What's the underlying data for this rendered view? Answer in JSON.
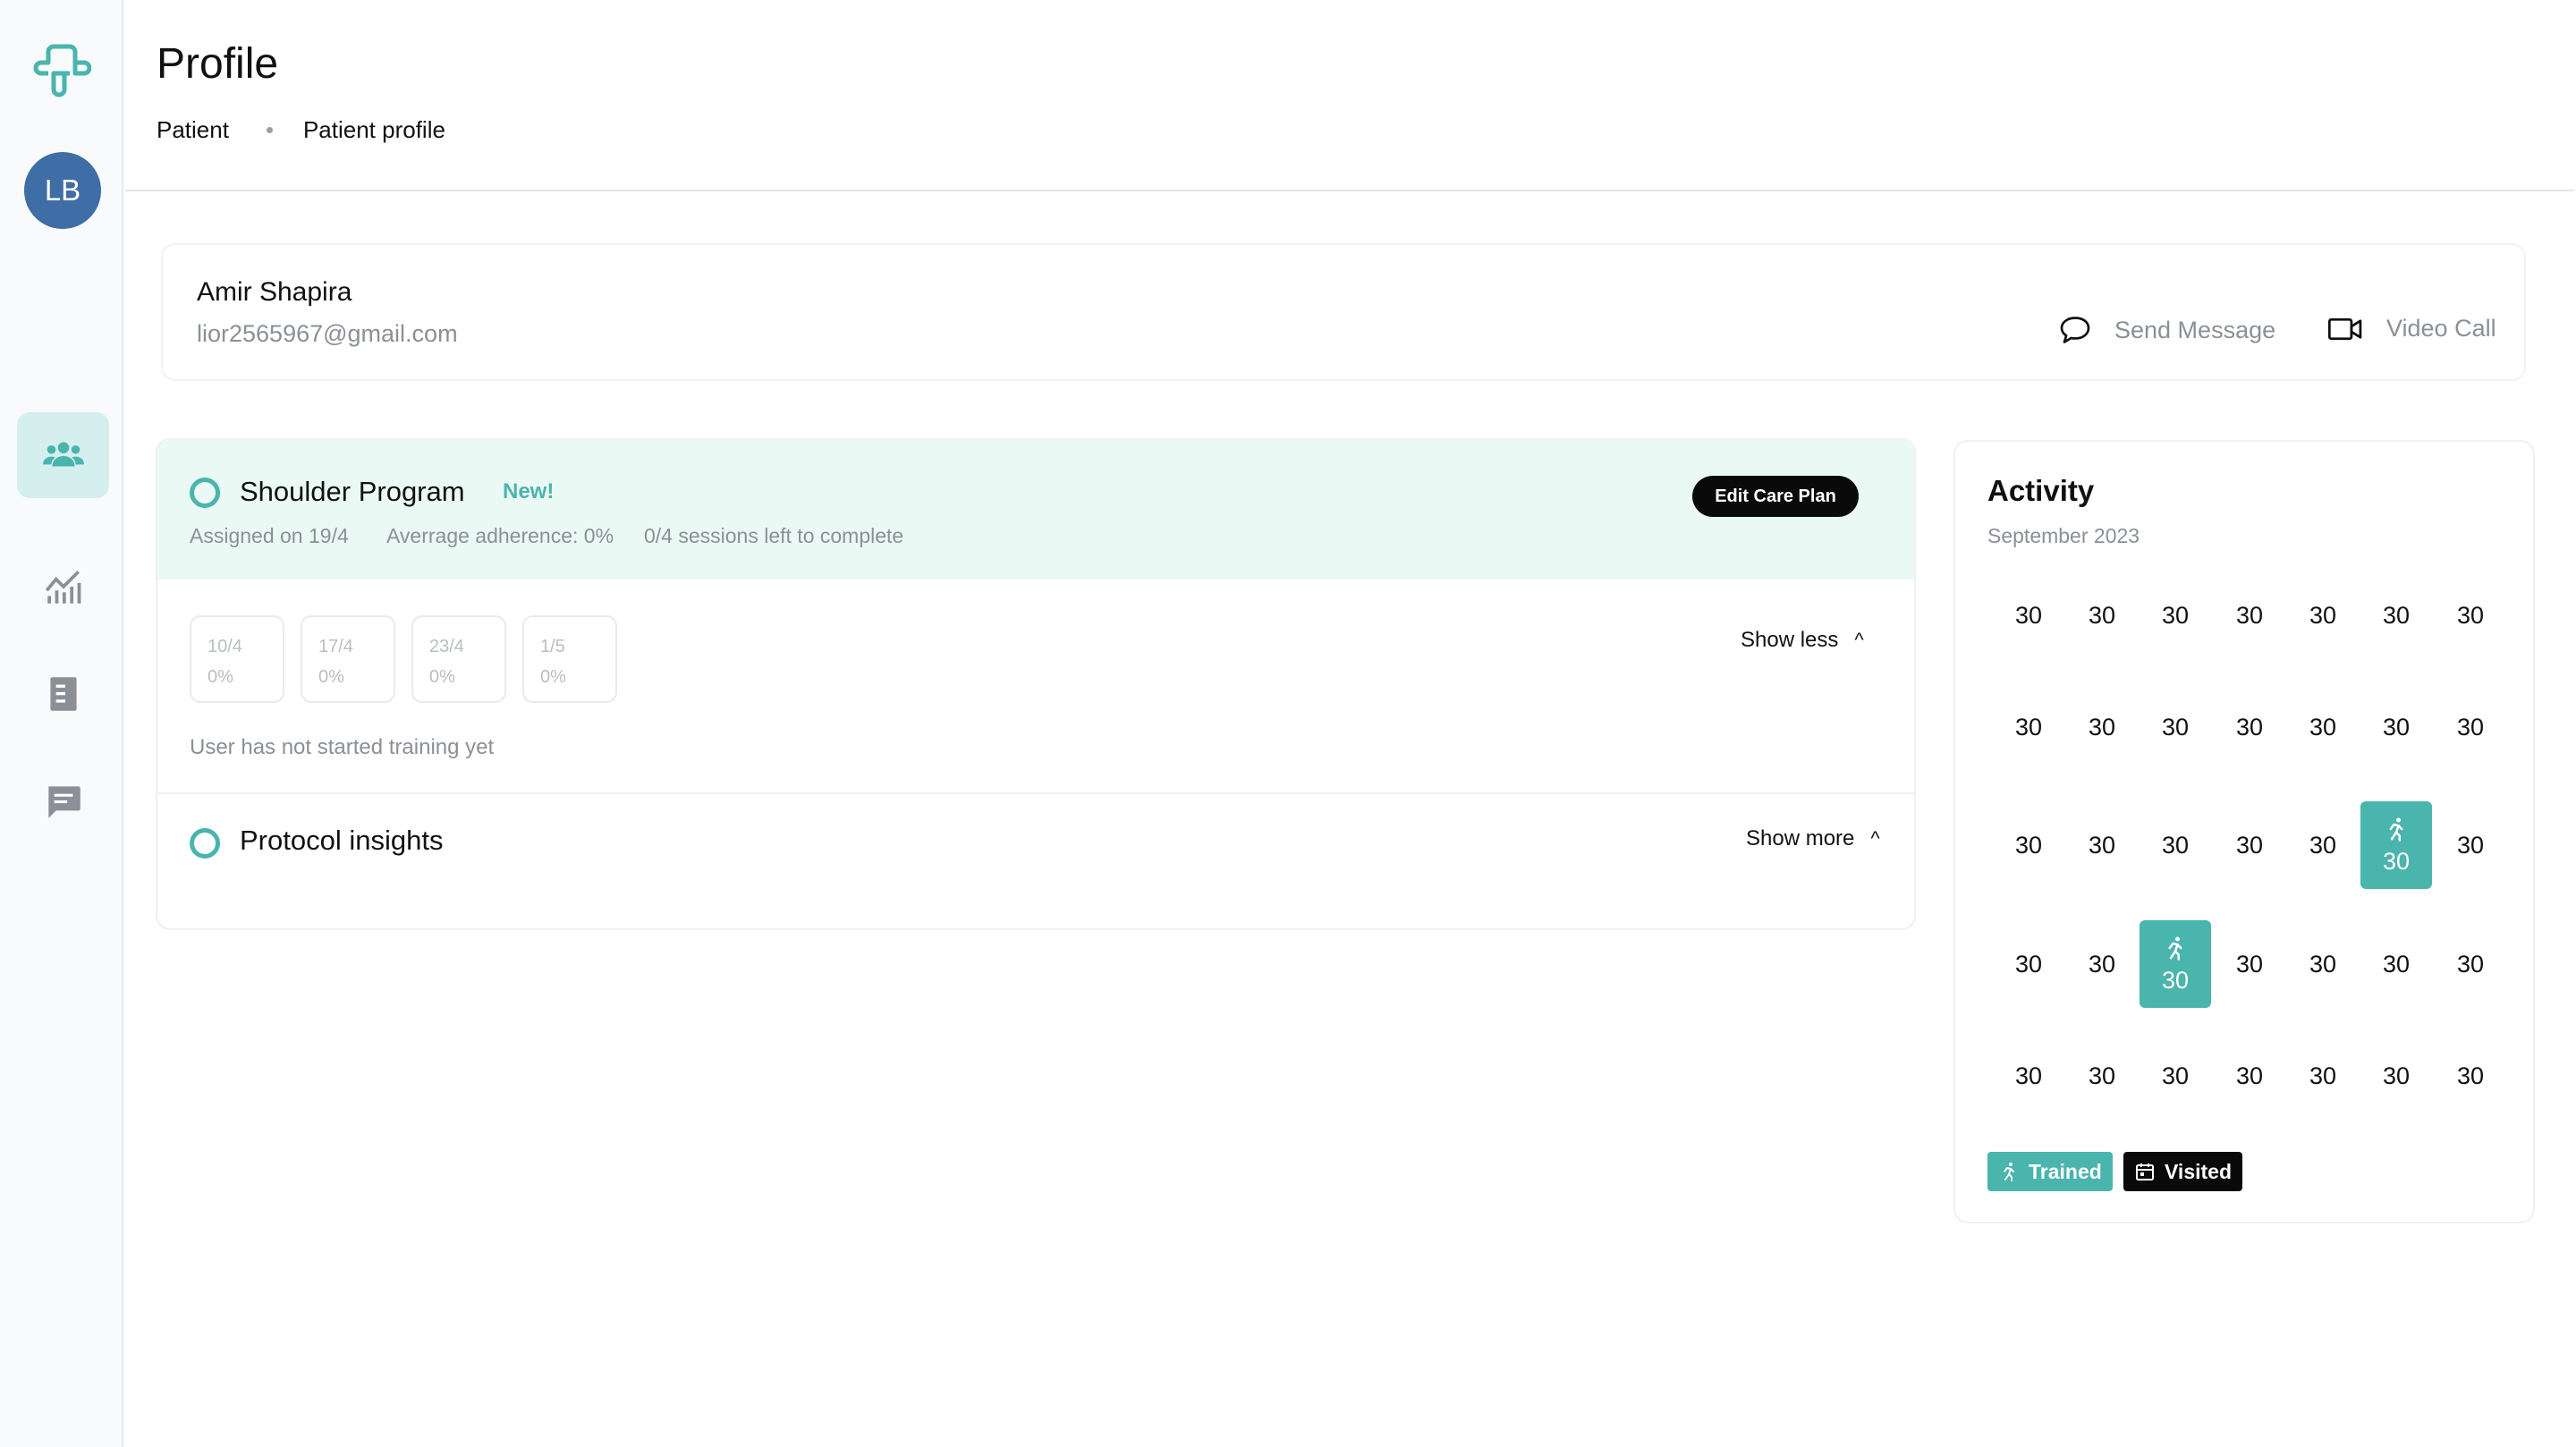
{
  "app": {
    "avatar_initials": "LB",
    "accent_color": "#4ab5ad",
    "nav": [
      {
        "name": "patients",
        "icon": "users-icon",
        "active": true
      },
      {
        "name": "analytics",
        "icon": "chart-icon",
        "active": false
      },
      {
        "name": "documents",
        "icon": "document-icon",
        "active": false
      },
      {
        "name": "messages",
        "icon": "chat-icon",
        "active": false
      }
    ]
  },
  "header": {
    "title": "Profile",
    "breadcrumb": [
      "Patient",
      "Patient profile"
    ]
  },
  "patient": {
    "name": "Amir Shapira",
    "email": "lior2565967@gmail.com",
    "send_message": "Send Message",
    "video_call": "Video Call"
  },
  "program": {
    "title": "Shoulder Program",
    "badge": "New!",
    "assigned": "Assigned on 19/4",
    "adherence": "Averrage adherence: 0%",
    "sessions_left": "0/4 sessions left to complete",
    "edit_button": "Edit Care Plan",
    "show_less": "Show less",
    "caret_up": "^",
    "sessions": [
      {
        "date": "10/4",
        "pct": "0%"
      },
      {
        "date": "17/4",
        "pct": "0%"
      },
      {
        "date": "23/4",
        "pct": "0%"
      },
      {
        "date": "1/5",
        "pct": "0%"
      }
    ],
    "status": "User has not started training yet"
  },
  "insights": {
    "title": "Protocol insights",
    "show_more": "Show more",
    "caret_up": "^"
  },
  "activity": {
    "title": "Activity",
    "month": "September 2023",
    "rows": [
      [
        {
          "d": "30"
        },
        {
          "d": "30"
        },
        {
          "d": "30"
        },
        {
          "d": "30"
        },
        {
          "d": "30"
        },
        {
          "d": "30"
        },
        {
          "d": "30"
        }
      ],
      [
        {
          "d": "30"
        },
        {
          "d": "30"
        },
        {
          "d": "30"
        },
        {
          "d": "30"
        },
        {
          "d": "30"
        },
        {
          "d": "30"
        },
        {
          "d": "30"
        }
      ],
      [
        {
          "d": "30"
        },
        {
          "d": "30"
        },
        {
          "d": "30"
        },
        {
          "d": "30"
        },
        {
          "d": "30"
        },
        {
          "d": "30",
          "trained": true
        },
        {
          "d": "30"
        }
      ],
      [
        {
          "d": "30"
        },
        {
          "d": "30"
        },
        {
          "d": "30",
          "trained": true
        },
        {
          "d": "30"
        },
        {
          "d": "30"
        },
        {
          "d": "30"
        },
        {
          "d": "30"
        }
      ],
      [
        {
          "d": "30"
        },
        {
          "d": "30"
        },
        {
          "d": "30"
        },
        {
          "d": "30"
        },
        {
          "d": "30"
        },
        {
          "d": "30"
        },
        {
          "d": "30"
        }
      ]
    ],
    "legend_trained": "Trained",
    "legend_visited": "Visited",
    "trained_color": "#4ab5ad",
    "visited_color": "#0a0a0a"
  }
}
